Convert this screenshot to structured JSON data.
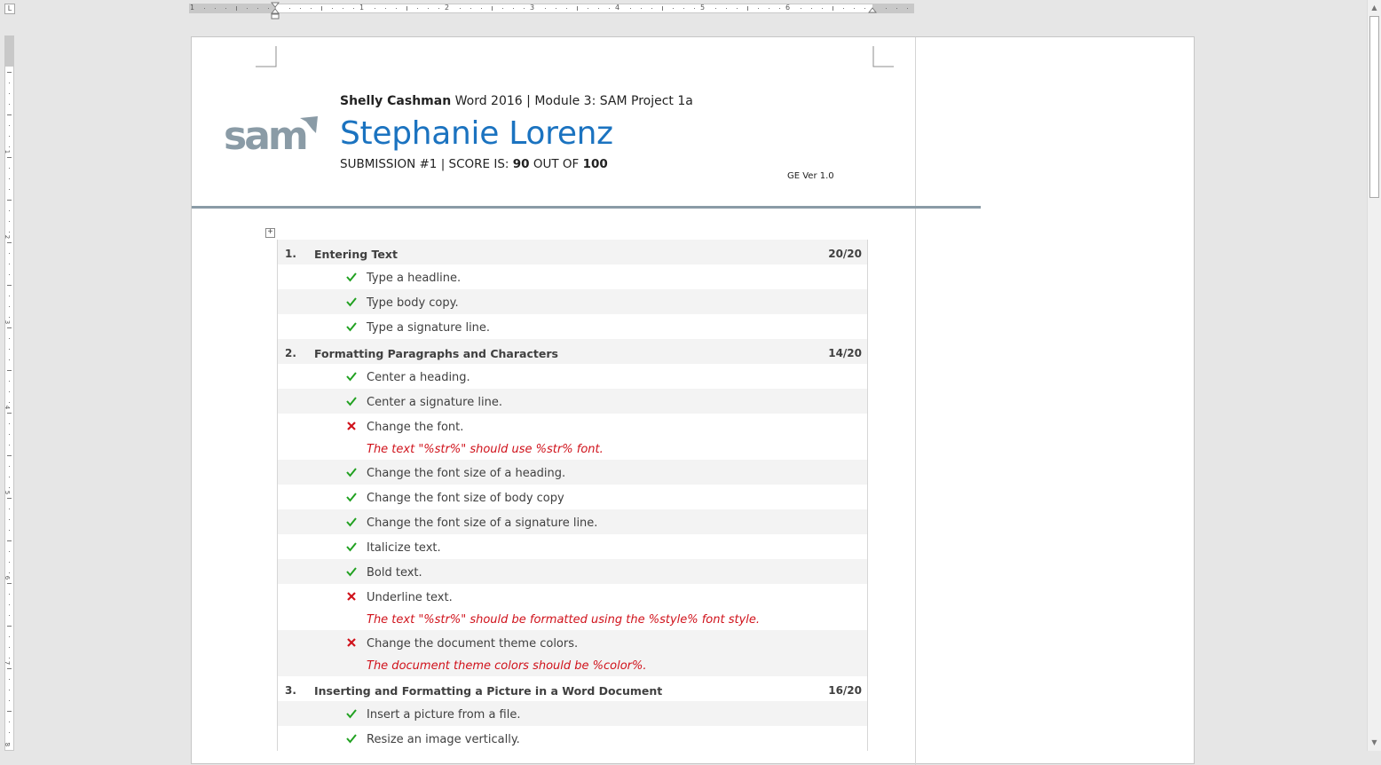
{
  "ruler": {
    "corner_symbol": "L",
    "h_numbers": [
      "1",
      "1",
      "2",
      "3",
      "4",
      "5",
      "6"
    ],
    "v_numbers": [
      "1",
      "2",
      "3",
      "4",
      "5",
      "6",
      "7",
      "8"
    ]
  },
  "header": {
    "brand": "Shelly Cashman",
    "course": "Word 2016",
    "separator": "|",
    "module": "Module 3: SAM Project 1a",
    "student": "Stephanie Lorenz",
    "submission": "SUBMISSION #1",
    "score_label": "SCORE IS:",
    "score": "90",
    "out_of_label": "OUT OF",
    "total": "100",
    "version": "GE Ver 1.0",
    "logo_text": "sam",
    "logo_color": "#8a9ba6",
    "name_color": "#1b73c0"
  },
  "table_move_handle_symbol": "+",
  "report": {
    "sections": [
      {
        "num": "1.",
        "title": "Entering Text",
        "score": "20/20",
        "items": [
          {
            "status": "pass",
            "text": "Type a headline."
          },
          {
            "status": "pass",
            "text": "Type body copy."
          },
          {
            "status": "pass",
            "text": "Type a signature line."
          }
        ]
      },
      {
        "num": "2.",
        "title": "Formatting Paragraphs and Characters",
        "score": "14/20",
        "items": [
          {
            "status": "pass",
            "text": "Center a heading."
          },
          {
            "status": "pass",
            "text": "Center a signature line."
          },
          {
            "status": "fail",
            "text": "Change the font.",
            "feedback": "The text \"%str%\" should use %str% font."
          },
          {
            "status": "pass",
            "text": "Change the font size of a heading."
          },
          {
            "status": "pass",
            "text": "Change the font size of body copy"
          },
          {
            "status": "pass",
            "text": "Change the font size of a signature line."
          },
          {
            "status": "pass",
            "text": "Italicize text."
          },
          {
            "status": "pass",
            "text": "Bold text."
          },
          {
            "status": "fail",
            "text": "Underline text.",
            "feedback": "The text \"%str%\" should be formatted using the %style% font style."
          },
          {
            "status": "fail",
            "text": "Change the document theme colors.",
            "feedback": "The document theme colors should be %color%."
          }
        ]
      },
      {
        "num": "3.",
        "title": "Inserting and Formatting a Picture in a Word Document",
        "score": "16/20",
        "items": [
          {
            "status": "pass",
            "text": "Insert a picture from a file."
          },
          {
            "status": "pass",
            "text": "Resize an image vertically."
          }
        ]
      }
    ]
  },
  "scrollbar": {
    "up_arrow": "▲",
    "down_arrow": "▼"
  },
  "colors": {
    "pass": "#21a121",
    "fail": "#d0121b",
    "text": "#404040",
    "row_alt": "#f3f3f3"
  }
}
